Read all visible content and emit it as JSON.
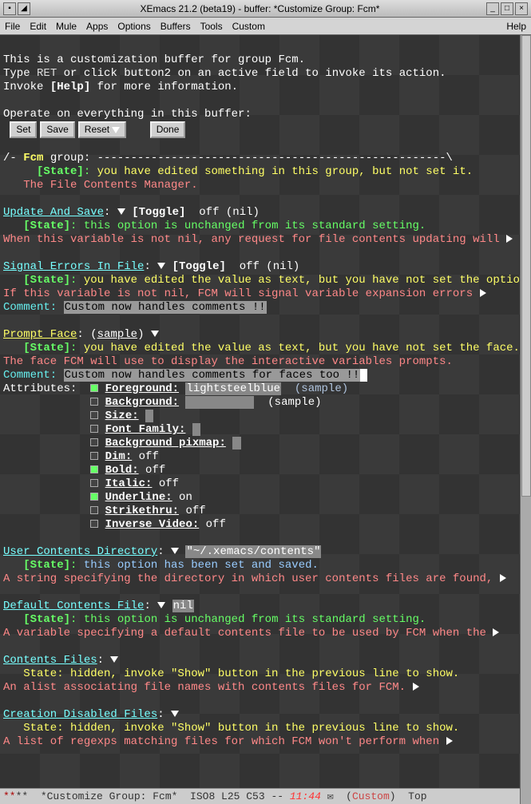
{
  "titlebar": {
    "title": "XEmacs 21.2 (beta19) - buffer: *Customize Group: Fcm*"
  },
  "menubar": {
    "items": [
      "File",
      "Edit",
      "Mule",
      "Apps",
      "Options",
      "Buffers",
      "Tools",
      "Custom"
    ],
    "help": "Help"
  },
  "intro": {
    "l1": "This is a customization buffer for group Fcm.",
    "l2_a": "Type ",
    "l2_b": "RET",
    "l2_c": " or click button2 on an active field to invoke its action.",
    "l3_a": "Invoke ",
    "l3_b": "[Help]",
    "l3_c": " for more information.",
    "operate": "Operate on everything in this buffer:"
  },
  "buttons": {
    "set": "Set",
    "save": "Save",
    "reset": "Reset",
    "done": "Done"
  },
  "group": {
    "line_a": "/- ",
    "line_b": "Fcm",
    "line_c": " group: ----------------------------------------------------\\",
    "state_lbl": "[State]",
    "state_txt": "you have edited something in this group, but not set it.",
    "desc": "The File Contents Manager."
  },
  "update_and_save": {
    "title": "Update And Save",
    "toggle_lbl": "[Toggle]",
    "toggle_val": "off (nil)",
    "state_lbl": "[State]",
    "state_txt": "this option is unchanged from its standard setting.",
    "desc": "When this variable is not nil, any request for file contents updating will"
  },
  "signal_errors": {
    "title": "Signal Errors In File",
    "toggle_lbl": "[Toggle]",
    "toggle_val": "off (nil)",
    "state_lbl": "[State]",
    "state_txt": "you have edited the value as text, but you have not set the option.",
    "desc": "If this variable is not nil, FCM will signal variable expansion errors",
    "comment_lbl": "Comment:",
    "comment_val": "Custom now handles comments !!"
  },
  "prompt_face": {
    "title": "Prompt Face",
    "sample": "sample",
    "state_lbl": "[State]",
    "state_txt": "you have edited the value as text, but you have not set the face.",
    "desc": "The face FCM will use to display the interactive variables prompts.",
    "comment_lbl": "Comment:",
    "comment_val": "Custom now handles comments for faces too !!",
    "attr_lbl": "Attributes:",
    "attrs": {
      "fg_lbl": "Foreground:",
      "fg_val": "lightsteelblue",
      "fg_sample": "(sample)",
      "bg_lbl": "Background:",
      "bg_val": "          ",
      "bg_sample": "(sample)",
      "size_lbl": "Size:",
      "size_val": " ",
      "ff_lbl": "Font Family:",
      "ff_val": " ",
      "bp_lbl": "Background pixmap:",
      "bp_val": " ",
      "dim_lbl": "Dim:",
      "dim_val": "off",
      "bold_lbl": "Bold:",
      "bold_val": "off",
      "italic_lbl": "Italic:",
      "italic_val": "off",
      "under_lbl": "Underline:",
      "under_val": "on",
      "strike_lbl": "Strikethru:",
      "strike_val": "off",
      "iv_lbl": "Inverse Video:",
      "iv_val": "off"
    }
  },
  "user_contents_dir": {
    "title": "User Contents Directory",
    "value": "\"~/.xemacs/contents\"",
    "state_lbl": "[State]",
    "state_txt": "this option has been set and saved.",
    "desc": "A string specifying the directory in which user contents files are found,"
  },
  "default_contents_file": {
    "title": "Default Contents File",
    "value": "nil",
    "state_lbl": "[State]",
    "state_txt": "this option is unchanged from its standard setting.",
    "desc": "A variable specifying a default contents file to be used by FCM when the"
  },
  "contents_files": {
    "title": "Contents Files",
    "state_line": "   State: hidden, invoke \"Show\" button in the previous line to show.",
    "desc": "An alist associating file names with contents files for FCM."
  },
  "creation_disabled": {
    "title": "Creation Disabled Files",
    "state_line": "   State: hidden, invoke \"Show\" button in the previous line to show.",
    "desc": "A list of regexps matching files for which FCM won't perform when"
  },
  "modeline": {
    "left": "**  *Customize Group: Fcm*  ISO8 L25 C53 -- ",
    "time": "11:44",
    "mail": " ✉  (",
    "custom": "Custom",
    "end": ")  Top"
  }
}
